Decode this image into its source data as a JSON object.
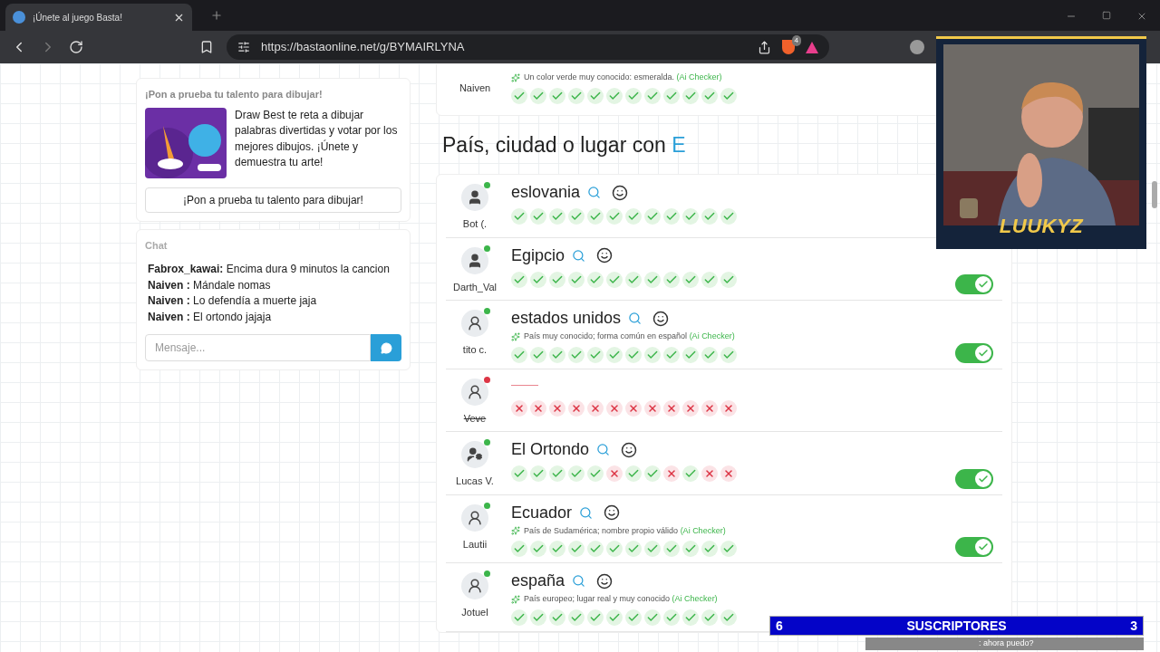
{
  "browser": {
    "tab_title": "¡Únete al juego Basta!",
    "url": "https://bastaonline.net/g/BYMAIRLYNA",
    "shield_badge": "4"
  },
  "promo": {
    "title": "¡Pon a prueba tu talento para dibujar!",
    "description": "Draw Best te reta a dibujar palabras divertidas y votar por los mejores dibujos. ¡Únete y demuestra tu arte!",
    "button": "¡Pon a prueba tu talento para dibujar!"
  },
  "chat": {
    "title": "Chat",
    "messages": [
      {
        "user": "Fabrox_kawai:",
        "text": "Encima dura 9 minutos la cancion"
      },
      {
        "user": "Naiven :",
        "text": "Mándale nomas"
      },
      {
        "user": "Naiven :",
        "text": "Lo defendía a muerte jaja"
      },
      {
        "user": "Naiven :",
        "text": "El ortondo jajaja"
      }
    ],
    "placeholder": "Mensaje..."
  },
  "previous_row": {
    "player": "Naiven",
    "hint": "Un color verde muy conocido: esmeralda.",
    "hint_source": "(Ai Checker)",
    "votes": [
      true,
      true,
      true,
      true,
      true,
      true,
      true,
      true,
      true,
      true,
      true,
      true
    ]
  },
  "category": {
    "title": "País, ciudad o lugar con",
    "letter": "E"
  },
  "rows": [
    {
      "player": "Bot (.",
      "avatar": {
        "kind": "filled"
      },
      "color": "#3cb54a",
      "struck": false,
      "kind": "word",
      "answer": "eslovania",
      "toggle": false,
      "votes": [
        true,
        true,
        true,
        true,
        true,
        true,
        true,
        true,
        true,
        true,
        true,
        true
      ]
    },
    {
      "player": "Darth_Val",
      "avatar": {
        "kind": "filled"
      },
      "color": "#3cb54a",
      "struck": false,
      "kind": "word",
      "answer": "Egipcio",
      "toggle": true,
      "votes": [
        true,
        true,
        true,
        true,
        true,
        true,
        true,
        true,
        true,
        true,
        true,
        true
      ]
    },
    {
      "player": "tito c.",
      "avatar": {
        "kind": "outline"
      },
      "color": "#3cb54a",
      "struck": false,
      "kind": "word",
      "answer": "estados unidos",
      "hint": "País muy conocido; forma común en español",
      "hint_source": "(Ai Checker)",
      "toggle": true,
      "votes": [
        true,
        true,
        true,
        true,
        true,
        true,
        true,
        true,
        true,
        true,
        true,
        true
      ]
    },
    {
      "player": "Veve",
      "avatar": {
        "kind": "outline"
      },
      "color": "#dc3545",
      "struck": true,
      "kind": "empty",
      "toggle": false,
      "votes": [
        false,
        false,
        false,
        false,
        false,
        false,
        false,
        false,
        false,
        false,
        false,
        false
      ]
    },
    {
      "player": "Lucas V.",
      "avatar": {
        "kind": "star"
      },
      "color": "#3cb54a",
      "struck": false,
      "kind": "word",
      "answer": "El Ortondo",
      "toggle": true,
      "votes": [
        true,
        true,
        true,
        true,
        true,
        false,
        true,
        true,
        false,
        true,
        false,
        false
      ]
    },
    {
      "player": "Lautii",
      "avatar": {
        "kind": "outline"
      },
      "color": "#3cb54a",
      "struck": false,
      "kind": "word",
      "answer": "Ecuador",
      "hint": "País de Sudamérica; nombre propio válido",
      "hint_source": "(Ai Checker)",
      "toggle": true,
      "votes": [
        true,
        true,
        true,
        true,
        true,
        true,
        true,
        true,
        true,
        true,
        true,
        true
      ]
    },
    {
      "player": "Jotuel",
      "avatar": {
        "kind": "outline"
      },
      "color": "#3cb54a",
      "struck": false,
      "kind": "word",
      "answer": "españa",
      "hint": "País europeo; lugar real y muy conocido",
      "hint_source": "(Ai Checker)",
      "toggle": false,
      "votes": [
        true,
        true,
        true,
        true,
        true,
        true,
        true,
        true,
        true,
        true,
        true,
        true
      ]
    }
  ],
  "overlay": {
    "streamer": "LUUKYZ",
    "goal_current": "6",
    "goal_label": "SUSCRIPTORES",
    "goal_target": "3",
    "ticker": ": ahora puedo?"
  }
}
